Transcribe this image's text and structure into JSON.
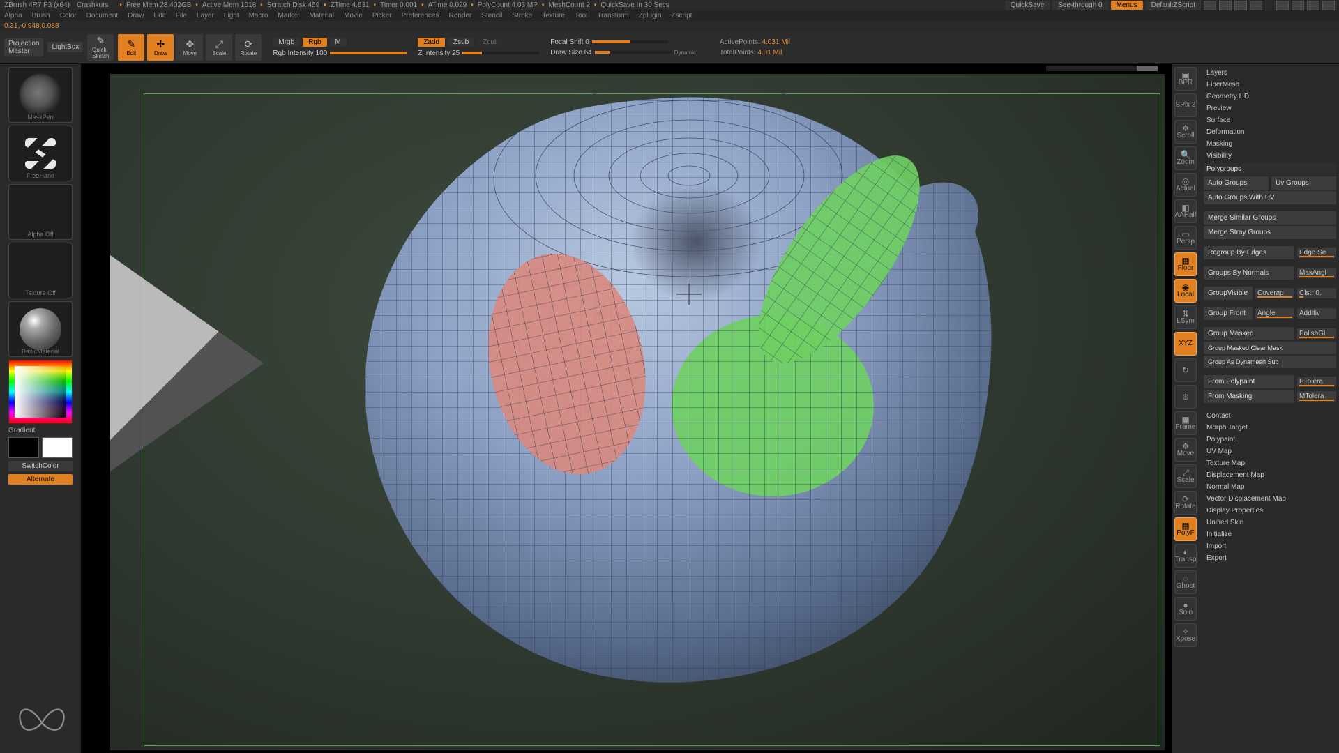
{
  "title": {
    "app": "ZBrush 4R7 P3 (x64)",
    "doc": "Crashkurs",
    "stats": [
      {
        "k": "Free Mem",
        "v": "28.402GB"
      },
      {
        "k": "Active Mem",
        "v": "1018"
      },
      {
        "k": "Scratch Disk",
        "v": "459"
      },
      {
        "k": "ZTime",
        "v": "4.631"
      },
      {
        "k": "Timer",
        "v": "0.001"
      },
      {
        "k": "ATime",
        "v": "0.029"
      },
      {
        "k": "PolyCount",
        "v": "4.03 MP"
      },
      {
        "k": "MeshCount",
        "v": "2"
      },
      {
        "k": "",
        "v": "QuickSave In 30 Secs"
      }
    ],
    "quicksave": "QuickSave",
    "seethrough": "See-through   0",
    "menus": "Menus",
    "script": "DefaultZScript"
  },
  "menus": [
    "Alpha",
    "Brush",
    "Color",
    "Document",
    "Draw",
    "Edit",
    "File",
    "Layer",
    "Light",
    "Macro",
    "Marker",
    "Material",
    "Movie",
    "Picker",
    "Preferences",
    "Render",
    "Stencil",
    "Stroke",
    "Texture",
    "Tool",
    "Transform",
    "Zplugin",
    "Zscript"
  ],
  "info": "0.31,-0.948,0.088",
  "toolbar": {
    "projection": "Projection\nMaster",
    "lightbox": "LightBox",
    "quicksketch": "Quick\nSketch",
    "modes": [
      {
        "lbl": "Edit",
        "active": true,
        "glyph": "✎"
      },
      {
        "lbl": "Draw",
        "active": true,
        "glyph": "✢"
      },
      {
        "lbl": "Move",
        "active": false,
        "glyph": "✥"
      },
      {
        "lbl": "Scale",
        "active": false,
        "glyph": "⤢"
      },
      {
        "lbl": "Rotate",
        "active": false,
        "glyph": "⟳"
      }
    ],
    "mrgb": "Mrgb",
    "rgb": "Rgb",
    "m": "M",
    "rgbIntensity": "Rgb Intensity 100",
    "zadd": "Zadd",
    "zsub": "Zsub",
    "zcut": "Zcut",
    "zIntensity": "Z Intensity 25",
    "focal": "Focal Shift 0",
    "drawSize": "Draw Size 64",
    "dynamic": "Dynamic",
    "active": "ActivePoints:",
    "activeV": "4.031 Mil",
    "total": "TotalPoints:",
    "totalV": "4.31 Mil"
  },
  "left": {
    "brush": "MaskPen",
    "stroke": "FreeHand",
    "alpha": "Alpha Off",
    "texture": "Texture Off",
    "material": "BasicMaterial",
    "gradient": "Gradient",
    "switch": "SwitchColor",
    "alternate": "Alternate"
  },
  "rail": [
    {
      "lbl": "BPR",
      "g": "▣"
    },
    {
      "lbl": "SPix 3",
      "g": ""
    },
    {
      "lbl": "Scroll",
      "g": "✥"
    },
    {
      "lbl": "Zoom",
      "g": "🔍"
    },
    {
      "lbl": "Actual",
      "g": "◎"
    },
    {
      "lbl": "AAHalf",
      "g": "◧"
    },
    {
      "lbl": "Persp",
      "g": "▭"
    },
    {
      "lbl": "Floor",
      "g": "▦",
      "active": true
    },
    {
      "lbl": "Local",
      "g": "◉",
      "active": true
    },
    {
      "lbl": "LSym",
      "g": "⇅"
    },
    {
      "lbl": "XYZ",
      "g": "",
      "active": true
    },
    {
      "lbl": "",
      "g": "↻"
    },
    {
      "lbl": "",
      "g": "⊕"
    },
    {
      "lbl": "Frame",
      "g": "▣"
    },
    {
      "lbl": "Move",
      "g": "✥"
    },
    {
      "lbl": "Scale",
      "g": "⤢"
    },
    {
      "lbl": "Rotate",
      "g": "⟳"
    },
    {
      "lbl": "PolyF",
      "g": "▦",
      "active": true
    },
    {
      "lbl": "Transp",
      "g": "◐"
    },
    {
      "lbl": "Ghost",
      "g": "◌"
    },
    {
      "lbl": "Solo",
      "g": "●"
    },
    {
      "lbl": "Xpose",
      "g": "✧"
    }
  ],
  "panel": {
    "sections_top": [
      "Layers",
      "FiberMesh",
      "Geometry HD",
      "Preview",
      "Surface",
      "Deformation",
      "Masking",
      "Visibility"
    ],
    "polygroups": "Polygroups",
    "autoGroups": "Auto Groups",
    "uvGroups": "Uv Groups",
    "autoUV": "Auto Groups With UV",
    "mergeSim": "Merge Similar Groups",
    "mergeStray": "Merge Stray Groups",
    "regroupEdges": "Regroup By Edges",
    "edgeSel": "Edge Se",
    "groupsNormals": "Groups By Normals",
    "maxAngle": "MaxAngl",
    "groupVisible": "GroupVisible",
    "coverage": "Coverag",
    "clstr": "Clstr 0.",
    "groupFront": "Group Front",
    "angle": "Angle",
    "additive": "Additiv",
    "groupMasked": "Group Masked",
    "polish": "PolishGl",
    "groupMaskedClear": "Group Masked Clear Mask",
    "groupDyna": "Group As Dynamesh Sub",
    "fromPoly": "From Polypaint",
    "ptol": "PTolera",
    "fromMask": "From Masking",
    "mtol": "MTolera",
    "sections_bot": [
      "Contact",
      "Morph Target",
      "Polypaint",
      "UV Map",
      "Texture Map",
      "Displacement Map",
      "Normal Map",
      "Vector Displacement Map",
      "Display Properties",
      "Unified Skin",
      "Initialize",
      "Import",
      "Export"
    ]
  }
}
